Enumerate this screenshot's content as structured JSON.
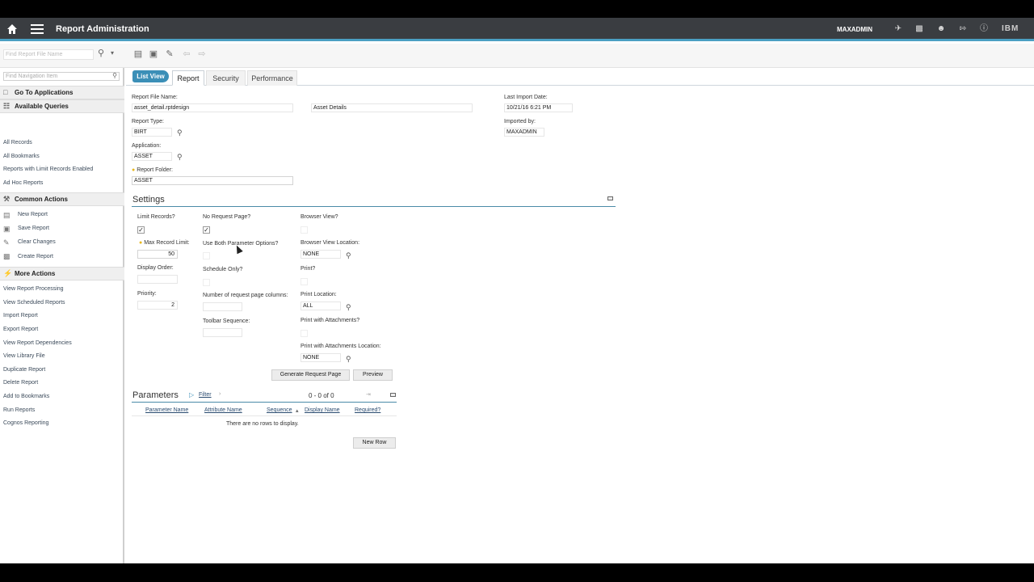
{
  "header": {
    "title": "Report Administration",
    "user": "MAXADMIN",
    "brand": "IBM",
    "icons": [
      "home-icon",
      "menu-icon",
      "send-icon",
      "chart-icon",
      "user-icon",
      "logout-icon",
      "help-icon"
    ]
  },
  "toolbar": {
    "find_placeholder": "Find Report File Name"
  },
  "sidebar": {
    "search_placeholder": "Find Navigation Item",
    "go_to_applications": "Go To Applications",
    "available_queries": "Available Queries",
    "queries": [
      "All Records",
      "All Bookmarks",
      "Reports with Limit Records Enabled",
      "Ad Hoc Reports"
    ],
    "common_actions": "Common Actions",
    "actions": [
      "New Report",
      "Save Report",
      "Clear Changes",
      "Create Report"
    ],
    "more_actions": "More Actions",
    "more": [
      "View Report Processing",
      "View Scheduled Reports",
      "Import Report",
      "Export Report",
      "View Report Dependencies",
      "View Library File",
      "Duplicate Report",
      "Delete Report",
      "Add to Bookmarks",
      "Run Reports",
      "Cognos Reporting"
    ]
  },
  "tabs": {
    "list_view": "List View",
    "report": "Report",
    "security": "Security",
    "performance": "Performance"
  },
  "form": {
    "report_file_name_label": "Report File Name:",
    "report_file_name": "asset_detail.rptdesign",
    "description": "Asset Details",
    "last_import_label": "Last Import Date:",
    "last_import": "10/21/16 6:21 PM",
    "report_type_label": "Report Type:",
    "report_type": "BIRT",
    "imported_by_label": "Imported by:",
    "imported_by": "MAXADMIN",
    "application_label": "Application:",
    "application": "ASSET",
    "report_folder_label": "Report Folder:",
    "report_folder": "ASSET"
  },
  "settings": {
    "title": "Settings",
    "limit_records_label": "Limit Records?",
    "limit_records": true,
    "max_record_limit_label": "Max Record Limit:",
    "max_record_limit": "50",
    "display_order_label": "Display Order:",
    "display_order": "",
    "priority_label": "Priority:",
    "priority": "2",
    "no_request_page_label": "No Request Page?",
    "no_request_page": true,
    "use_both_label": "Use Both Parameter Options?",
    "schedule_only_label": "Schedule Only?",
    "num_columns_label": "Number of request page columns:",
    "toolbar_sequence_label": "Toolbar Sequence:",
    "browser_view_label": "Browser View?",
    "browser_view_location_label": "Browser View Location:",
    "browser_view_location": "NONE",
    "print_label": "Print?",
    "print_location_label": "Print Location:",
    "print_location": "ALL",
    "print_attachments_label": "Print with Attachments?",
    "print_attachments_location_label": "Print with Attachments Location:",
    "print_attachments_location": "NONE",
    "generate_button": "Generate Request Page",
    "preview_button": "Preview"
  },
  "parameters": {
    "title": "Parameters",
    "filter": "Filter",
    "count": "0 - 0 of 0",
    "columns": [
      "Parameter Name",
      "Attribute Name",
      "Sequence",
      "Display Name",
      "Required?"
    ],
    "empty": "There are no rows to display.",
    "new_row": "New Row"
  }
}
